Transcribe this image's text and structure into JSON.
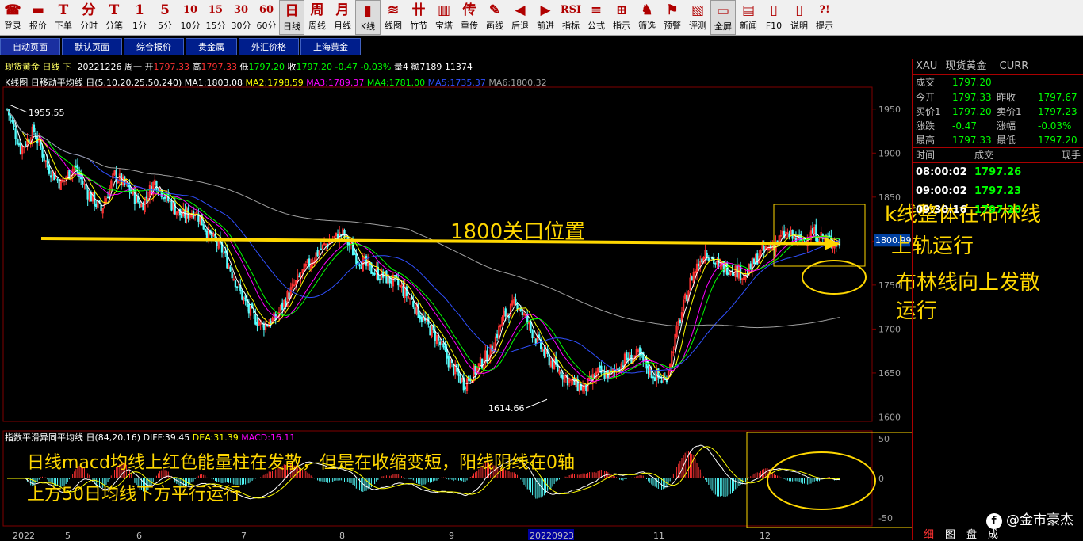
{
  "toolbar": [
    {
      "g": "☎",
      "l": "登录",
      "n": "login"
    },
    {
      "g": "▬",
      "l": "报价",
      "n": "quote"
    },
    {
      "g": "T",
      "l": "下单",
      "n": "order"
    },
    {
      "g": "分",
      "l": "分时",
      "n": "timeshare"
    },
    {
      "g": "T",
      "l": "分笔",
      "n": "tick"
    },
    {
      "g": "1",
      "l": "1分",
      "n": "1min"
    },
    {
      "g": "5",
      "l": "5分",
      "n": "5min"
    },
    {
      "g": "10",
      "l": "10分",
      "n": "10min"
    },
    {
      "g": "15",
      "l": "15分",
      "n": "15min"
    },
    {
      "g": "30",
      "l": "30分",
      "n": "30min"
    },
    {
      "g": "60",
      "l": "60分",
      "n": "60min"
    },
    {
      "g": "日",
      "l": "日线",
      "n": "daily",
      "sel": true
    },
    {
      "g": "周",
      "l": "周线",
      "n": "weekly"
    },
    {
      "g": "月",
      "l": "月线",
      "n": "monthly"
    },
    {
      "g": "▮",
      "l": "K线",
      "n": "kline",
      "sel": true
    },
    {
      "g": "≋",
      "l": "线图",
      "n": "linechart"
    },
    {
      "g": "卄",
      "l": "竹节",
      "n": "bamboo"
    },
    {
      "g": "▥",
      "l": "宝塔",
      "n": "tower"
    },
    {
      "g": "传",
      "l": "重传",
      "n": "reload"
    },
    {
      "g": "✎",
      "l": "画线",
      "n": "draw"
    },
    {
      "g": "◀",
      "l": "后退",
      "n": "back"
    },
    {
      "g": "▶",
      "l": "前进",
      "n": "forward"
    },
    {
      "g": "RSI",
      "l": "指标",
      "n": "indicator"
    },
    {
      "g": "≡",
      "l": "公式",
      "n": "formula"
    },
    {
      "g": "⊞",
      "l": "指示",
      "n": "indicate"
    },
    {
      "g": "♞",
      "l": "筛选",
      "n": "filter"
    },
    {
      "g": "⚑",
      "l": "预警",
      "n": "alert"
    },
    {
      "g": "▧",
      "l": "评测",
      "n": "evaluate"
    },
    {
      "g": "▭",
      "l": "全屏",
      "n": "fullscreen",
      "sel": true
    },
    {
      "g": "▤",
      "l": "新闻",
      "n": "news"
    },
    {
      "g": "▯",
      "l": "F10",
      "n": "f10"
    },
    {
      "g": "▯",
      "l": "说明",
      "n": "manual"
    },
    {
      "g": "?!",
      "l": "提示",
      "n": "tips"
    }
  ],
  "tabs": [
    "自动页面",
    "默认页面",
    "综合报价",
    "贵金属",
    "外汇价格",
    "上海黄金"
  ],
  "infobar": {
    "name": "现货黄金 日线 下",
    "date": "20221226 周一",
    "open_label": "开",
    "open": "1797.33",
    "high_label": "高",
    "high": "1797.33",
    "low_label": "低",
    "low": "1797.20",
    "close_label": "收",
    "close": "1797.20",
    "change": "-0.47 -0.03%",
    "vol": "量4 额7189 11374"
  },
  "malegend": {
    "title": "K线图 日移动平均线 日(5,10,20,25,50,240)",
    "ma1": "MA1:1803.08",
    "ma2": "MA2:1798.59",
    "ma3": "MA3:1789.37",
    "ma4": "MA4:1781.00",
    "ma5": "MA5:1735.37",
    "ma6": "MA6:1800.32"
  },
  "macdlegend": {
    "title": "指数平滑异同平均线 日(84,20,16)",
    "diff": "DIFF:39.45",
    "dea": "DEA:31.39",
    "macd": "MACD:16.11"
  },
  "side": {
    "symbol": "XAU",
    "name": "现货黄金",
    "code": "CURR",
    "trade_label": "成交",
    "trade": "1797.20",
    "rows": [
      {
        "l1": "今开",
        "v1": "1797.33",
        "l2": "昨收",
        "v2": "1797.67"
      },
      {
        "l1": "买价1",
        "v1": "1797.20",
        "l2": "卖价1",
        "v2": "1797.23"
      },
      {
        "l1": "涨跌",
        "v1": "-0.47",
        "l2": "涨幅",
        "v2": "-0.03%"
      },
      {
        "l1": "最高",
        "v1": "1797.33",
        "l2": "最低",
        "v2": "1797.20"
      }
    ],
    "ticks_header": {
      "time": "时间",
      "trade": "成交",
      "now": "现手"
    },
    "ticks": [
      {
        "t": "08:00:02",
        "p": "1797.26"
      },
      {
        "t": "09:00:02",
        "p": "1797.23"
      },
      {
        "t": "09:30:16",
        "p": "1797.20"
      }
    ]
  },
  "chart_data": {
    "type": "candlestick",
    "title": "现货黄金 日线",
    "ylim": [
      1595,
      1975
    ],
    "yticks": [
      1600,
      1650,
      1700,
      1750,
      1800,
      1850,
      1900,
      1950
    ],
    "xticks": [
      "2022",
      "5",
      "6",
      "7",
      "8",
      "9",
      "20220923",
      "11",
      "12"
    ],
    "current_price_label": "1800.99",
    "max_label": "1955.55",
    "min_label": "1614.66",
    "price_path": [
      [
        0,
        1950
      ],
      [
        8,
        1905
      ],
      [
        16,
        1925
      ],
      [
        24,
        1885
      ],
      [
        32,
        1865
      ],
      [
        40,
        1885
      ],
      [
        48,
        1855
      ],
      [
        56,
        1835
      ],
      [
        64,
        1875
      ],
      [
        72,
        1860
      ],
      [
        80,
        1840
      ],
      [
        88,
        1868
      ],
      [
        96,
        1846
      ],
      [
        104,
        1828
      ],
      [
        112,
        1835
      ],
      [
        120,
        1808
      ],
      [
        128,
        1790
      ],
      [
        136,
        1755
      ],
      [
        144,
        1720
      ],
      [
        152,
        1704
      ],
      [
        160,
        1712
      ],
      [
        168,
        1740
      ],
      [
        176,
        1764
      ],
      [
        184,
        1785
      ],
      [
        192,
        1800
      ],
      [
        200,
        1808
      ],
      [
        208,
        1782
      ],
      [
        216,
        1768
      ],
      [
        224,
        1760
      ],
      [
        232,
        1752
      ],
      [
        240,
        1735
      ],
      [
        248,
        1710
      ],
      [
        256,
        1690
      ],
      [
        264,
        1660
      ],
      [
        272,
        1638
      ],
      [
        280,
        1655
      ],
      [
        288,
        1675
      ],
      [
        296,
        1715
      ],
      [
        304,
        1730
      ],
      [
        312,
        1700
      ],
      [
        320,
        1672
      ],
      [
        328,
        1654
      ],
      [
        336,
        1640
      ],
      [
        344,
        1632
      ],
      [
        352,
        1650
      ],
      [
        360,
        1648
      ],
      [
        368,
        1665
      ],
      [
        376,
        1670
      ],
      [
        384,
        1650
      ],
      [
        392,
        1640
      ],
      [
        400,
        1705
      ],
      [
        408,
        1760
      ],
      [
        416,
        1790
      ],
      [
        424,
        1770
      ],
      [
        432,
        1770
      ],
      [
        440,
        1760
      ],
      [
        448,
        1785
      ],
      [
        456,
        1795
      ],
      [
        464,
        1808
      ],
      [
        472,
        1800
      ],
      [
        480,
        1810
      ],
      [
        488,
        1802
      ],
      [
        496,
        1797
      ]
    ],
    "macd_ylim": [
      -60,
      60
    ],
    "macd_yticks": [
      -50,
      0,
      50
    ]
  },
  "annotations": {
    "level": "1800关口位置",
    "kline": "k线整体在布林线",
    "kline2": "上轨运行",
    "boll": "布林线向上发散",
    "boll2": "运行",
    "macd1": "日线macd均线上红色能量柱在发散，但是在收缩变短，阳线阴线在0轴",
    "macd2": "上方50日均线下方平行运行"
  },
  "watermark": "@金市豪杰",
  "bottom_tabs": [
    "细",
    "图",
    "盘",
    "成"
  ],
  "colors": {
    "up": "#ff3232",
    "down": "#54ffff",
    "grid": "#800000",
    "ma1": "#ffffff",
    "ma2": "#ffff00",
    "ma3": "#ff00ff",
    "ma4": "#00ff00",
    "ma5": "#3050ff",
    "ma6": "#a0a0a0",
    "annotation": "#ffd700"
  }
}
